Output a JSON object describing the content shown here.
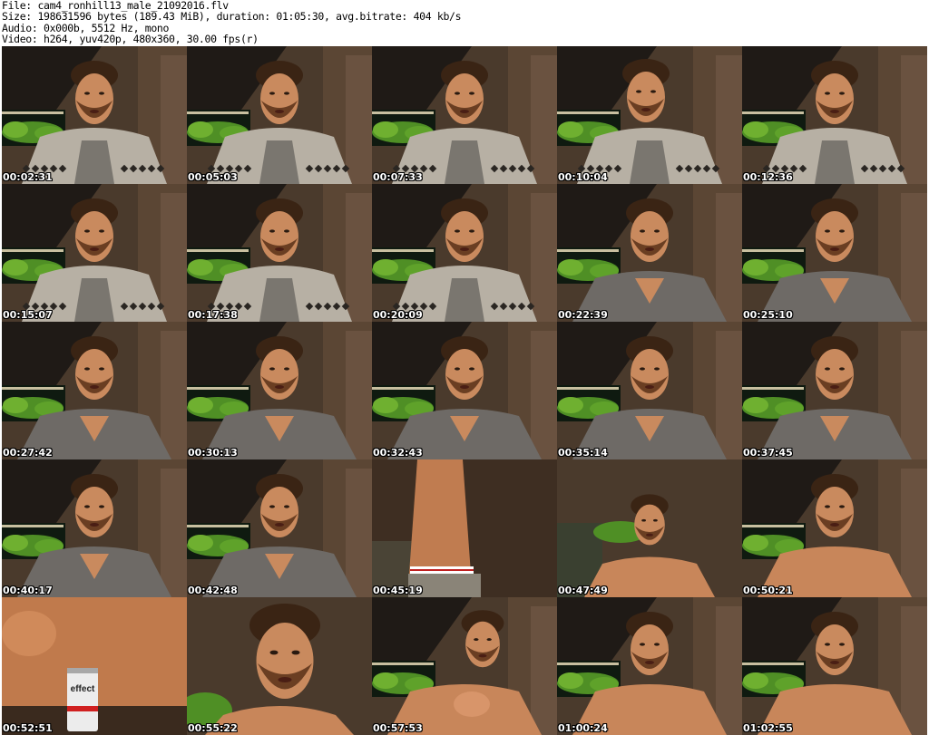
{
  "header": {
    "line1": "File: cam4_ronhill13_male_21092016.flv",
    "line2": "Size: 198631596 bytes (189.43 MiB), duration: 01:05:30, avg.bitrate: 404 kb/s",
    "line3": "Audio: 0x000b, 5512 Hz, mono",
    "line4": "Video: h264, yuv420p, 480x360, 30.00 fps(r)"
  },
  "thumbnails": [
    {
      "time": "00:02:31",
      "scene": "cardigan"
    },
    {
      "time": "00:05:03",
      "scene": "cardigan"
    },
    {
      "time": "00:07:33",
      "scene": "cardigan"
    },
    {
      "time": "00:10:04",
      "scene": "cardigan-profile"
    },
    {
      "time": "00:12:36",
      "scene": "cardigan"
    },
    {
      "time": "00:15:07",
      "scene": "cardigan"
    },
    {
      "time": "00:17:38",
      "scene": "cardigan"
    },
    {
      "time": "00:20:09",
      "scene": "cardigan"
    },
    {
      "time": "00:22:39",
      "scene": "tshirt"
    },
    {
      "time": "00:25:10",
      "scene": "tshirt"
    },
    {
      "time": "00:27:42",
      "scene": "tshirt"
    },
    {
      "time": "00:30:13",
      "scene": "tshirt"
    },
    {
      "time": "00:32:43",
      "scene": "tshirt"
    },
    {
      "time": "00:35:14",
      "scene": "tshirt"
    },
    {
      "time": "00:37:45",
      "scene": "tshirt"
    },
    {
      "time": "00:40:17",
      "scene": "tshirt"
    },
    {
      "time": "00:42:48",
      "scene": "tshirt"
    },
    {
      "time": "00:45:19",
      "scene": "standing"
    },
    {
      "time": "00:47:49",
      "scene": "shirtless-far"
    },
    {
      "time": "00:50:21",
      "scene": "shirtless"
    },
    {
      "time": "00:52:51",
      "scene": "can"
    },
    {
      "time": "00:55:22",
      "scene": "closeup"
    },
    {
      "time": "00:57:53",
      "scene": "shirtless-fist"
    },
    {
      "time": "01:00:24",
      "scene": "shirtless"
    },
    {
      "time": "01:02:55",
      "scene": "shirtless"
    }
  ],
  "can_label": "effect"
}
